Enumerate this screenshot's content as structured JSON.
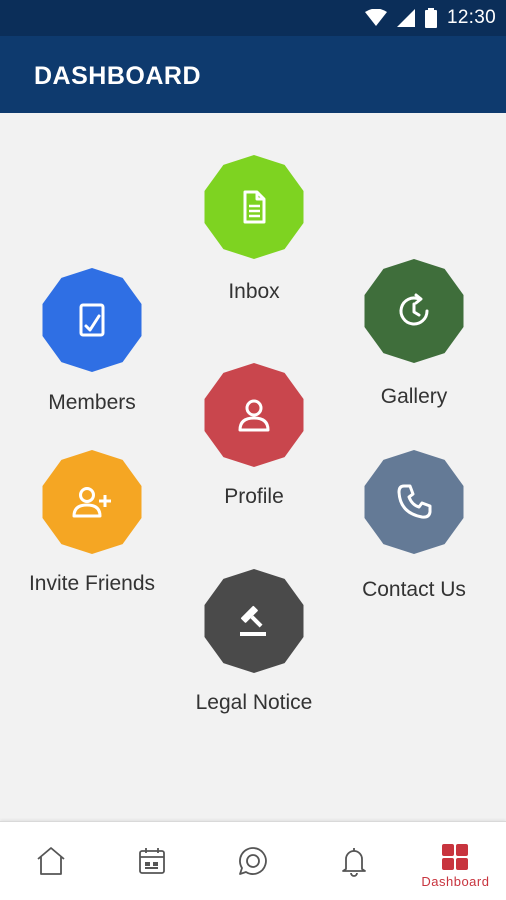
{
  "status_bar": {
    "time": "12:30"
  },
  "app_bar": {
    "title": "DASHBOARD"
  },
  "tiles": [
    {
      "key": "inbox",
      "label": "Inbox",
      "color": "#7ed321",
      "icon": "document-icon"
    },
    {
      "key": "members",
      "label": "Members",
      "color": "#2f6fe4",
      "icon": "member-card-icon"
    },
    {
      "key": "gallery",
      "label": "Gallery",
      "color": "#3f6e3b",
      "icon": "clock-refresh-icon"
    },
    {
      "key": "profile",
      "label": "Profile",
      "color": "#c9464d",
      "icon": "user-icon"
    },
    {
      "key": "invite",
      "label": "Invite Friends",
      "color": "#f5a623",
      "icon": "add-user-icon"
    },
    {
      "key": "contact",
      "label": "Contact Us",
      "color": "#647a96",
      "icon": "phone-icon"
    },
    {
      "key": "legal",
      "label": "Legal Notice",
      "color": "#4a4a4a",
      "icon": "gavel-icon"
    }
  ],
  "bottom_nav": {
    "items": [
      {
        "key": "home",
        "icon": "home-icon",
        "label": ""
      },
      {
        "key": "calendar",
        "icon": "calendar-icon",
        "label": ""
      },
      {
        "key": "chat",
        "icon": "chat-icon",
        "label": ""
      },
      {
        "key": "notifications",
        "icon": "bell-icon",
        "label": ""
      },
      {
        "key": "dashboard",
        "icon": "grid-icon",
        "label": "Dashboard",
        "active": true
      }
    ],
    "active_color": "#c8343e"
  }
}
